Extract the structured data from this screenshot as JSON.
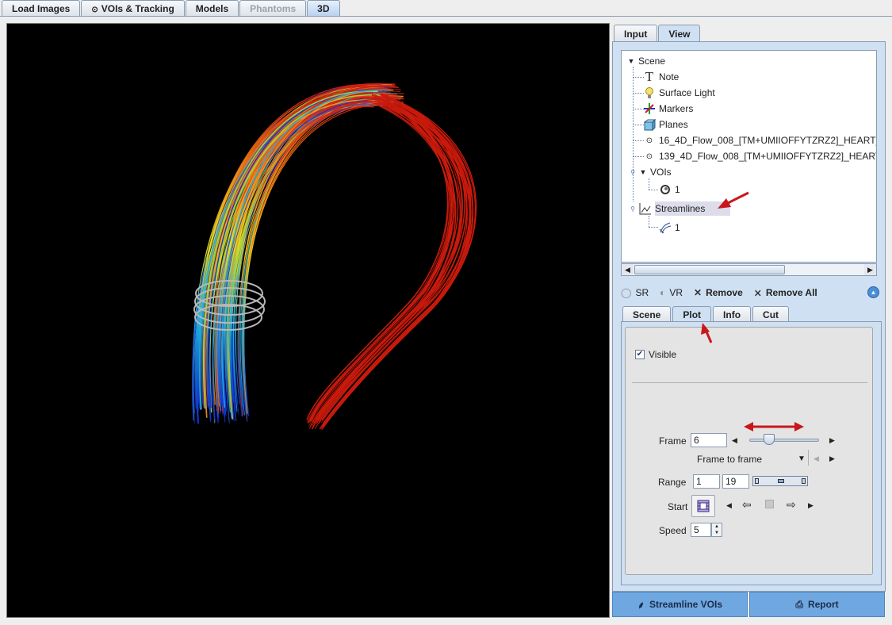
{
  "top_tabs": [
    {
      "label": "Load Images",
      "state": "normal"
    },
    {
      "label": "VOIs & Tracking",
      "state": "normal"
    },
    {
      "label": "Models",
      "state": "normal"
    },
    {
      "label": "Phantoms",
      "state": "disabled"
    },
    {
      "label": "3D",
      "state": "active"
    }
  ],
  "right_tabs": {
    "input": "Input",
    "view": "View"
  },
  "tree": {
    "scene": "Scene",
    "note": "Note",
    "surface_light": "Surface Light",
    "markers": "Markers",
    "planes": "Planes",
    "series1": "16_4D_Flow_008_[TM+UMIIOFFYTZRZ2]_HEART_",
    "series2": "139_4D_Flow_008_[TM+UMIIOFFYTZRZ2]_HEART",
    "vois": "VOIs",
    "voi_item": "1",
    "streamlines": "Streamlines",
    "streamline_item": "1"
  },
  "toolbar": {
    "sr": "SR",
    "vr": "VR",
    "remove": "Remove",
    "remove_all": "Remove All"
  },
  "sub_tabs": {
    "scene": "Scene",
    "plot": "Plot",
    "info": "Info",
    "cut": "Cut"
  },
  "plot": {
    "visible_label": "Visible",
    "visible_checked": true,
    "frame_label": "Frame",
    "frame_value": "6",
    "frame_slider_fraction": 0.28,
    "mode_value": "Frame to frame",
    "range_label": "Range",
    "range_start": "1",
    "range_end": "19",
    "start_label": "Start",
    "speed_label": "Speed",
    "speed_value": "5"
  },
  "bottom_buttons": {
    "streamline_vois": "Streamline VOIs",
    "report": "Report"
  },
  "colors": {
    "accent_blue": "#6fa7e0",
    "annotation_red": "#c8171c",
    "viewport_bg": "#000000"
  }
}
